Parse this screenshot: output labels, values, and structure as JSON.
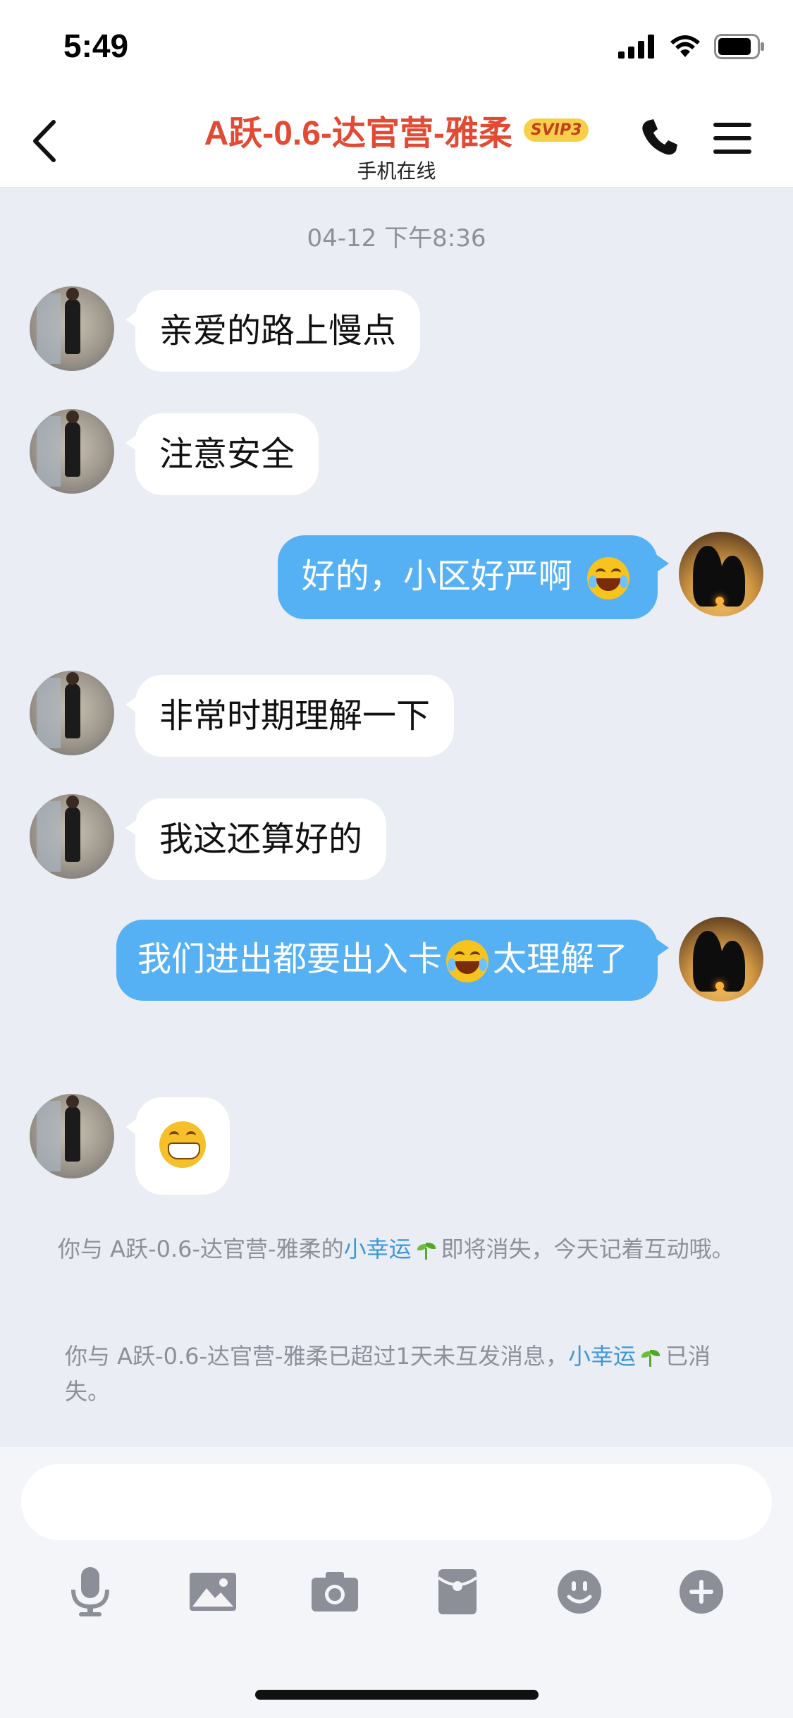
{
  "status_bar": {
    "time": "5:49"
  },
  "header": {
    "title": "A跃-0.6-达官营-雅柔",
    "badge": "SVIP3",
    "subtitle": "手机在线"
  },
  "chat": {
    "date": "04-12 下午8:36",
    "messages": [
      {
        "side": "left",
        "text": "亲爱的路上慢点"
      },
      {
        "side": "left",
        "text": "注意安全"
      },
      {
        "side": "right",
        "text": "好的，小区好严啊",
        "emoji": "tears-of-joy"
      },
      {
        "side": "left",
        "text": "非常时期理解一下"
      },
      {
        "side": "left",
        "text": "我这还算好的"
      },
      {
        "side": "right",
        "text_before": "我们进出都要出入卡",
        "emoji": "tears-of-joy",
        "text_after": "太理解了"
      },
      {
        "side": "left",
        "emoji": "grinning"
      }
    ],
    "notices": [
      {
        "before": "你与 A跃-0.6-达官营-雅柔的",
        "link": "小幸运",
        "after": "即将消失，今天记着互动哦。"
      },
      {
        "before": "你与 A跃-0.6-达官营-雅柔已超过1天未互发消息，",
        "link": "小幸运",
        "after": "已消失。"
      }
    ]
  },
  "input_bar": {
    "placeholder": "",
    "tools": [
      "microphone-icon",
      "image-icon",
      "camera-icon",
      "red-packet-icon",
      "emoji-icon",
      "plus-icon"
    ]
  }
}
